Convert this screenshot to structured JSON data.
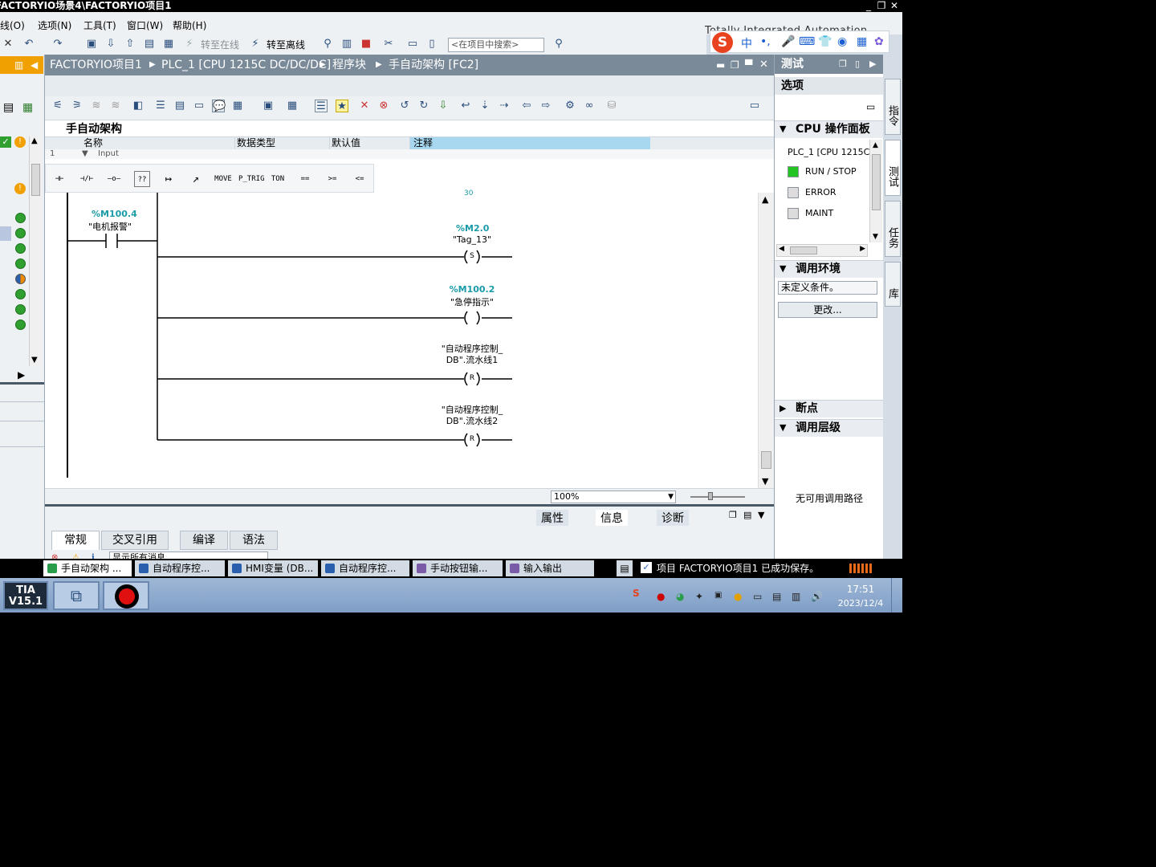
{
  "window": {
    "title": "FACTORYIO场景4\\FACTORYIO项目1",
    "min": "_",
    "restore": "❐",
    "close": "✕"
  },
  "menu": {
    "items": [
      "线(O)",
      "选项(N)",
      "工具(T)",
      "窗口(W)",
      "帮助(H)"
    ],
    "brand": "Totally Integrated Automation"
  },
  "toolbar": {
    "go_online": "转至在线",
    "go_offline": "转至离线",
    "search_placeholder": "<在项目中搜索>"
  },
  "ime": {
    "logo": "S",
    "lang": "中",
    "punct": "•,"
  },
  "editor": {
    "breadcrumb": [
      "FACTORYIO项目1",
      "PLC_1 [CPU 1215C DC/DC/DC]",
      "程序块",
      "手自动架构 [FC2]"
    ],
    "block_title": "手自动架构",
    "interface_columns": [
      "名称",
      "数据类型",
      "默认值",
      "注释"
    ],
    "interface_row": {
      "num": "1",
      "name": "Input"
    },
    "favorites": [
      "⊣⊢",
      "⊣/⊢",
      "–o–",
      "??",
      "↦",
      "↗",
      "MOVE",
      "P_TRIG",
      "TON",
      "==",
      ">=",
      "<="
    ],
    "zoom": "100%"
  },
  "ladder": {
    "contact": {
      "address": "%M100.4",
      "name": "\"电机报警\""
    },
    "coils": [
      {
        "address": "%M2.0",
        "name": "\"Tag_13\"",
        "type": "S"
      },
      {
        "address": "%M100.2",
        "name": "\"急停指示\"",
        "type": ""
      },
      {
        "address": "",
        "name": "\"自动程序控制_\nDB\".流水线1",
        "type": "R"
      },
      {
        "address": "",
        "name": "\"自动程序控制_\nDB\".流水线2",
        "type": "R"
      }
    ],
    "top_clip": "30"
  },
  "inspector": {
    "tabs": [
      "属性",
      "信息",
      "诊断"
    ],
    "subtabs": [
      "常规",
      "交叉引用",
      "编译",
      "语法"
    ],
    "filter_text": "显示所有消息"
  },
  "testpanel": {
    "title": "测试",
    "options": "选项",
    "cpu_panel": "CPU 操作面板",
    "plc_name": "PLC_1 [CPU 1215C",
    "leds": [
      {
        "label": "RUN / STOP",
        "color": "#22c522"
      },
      {
        "label": "ERROR",
        "color": "#dcdcdc"
      },
      {
        "label": "MAINT",
        "color": "#dcdcdc"
      }
    ],
    "call_env": "调用环境",
    "undefined_condition": "未定义条件。",
    "change_button": "更改...",
    "breakpoints": "断点",
    "call_hierarchy": "调用层级",
    "no_call_path": "无可用调用路径"
  },
  "vertical_tabs": [
    "指令",
    "测试",
    "任务",
    "库"
  ],
  "portal_tabs": [
    {
      "label": "手自动架构 ...",
      "active": true
    },
    {
      "label": "自动程序控...",
      "active": false
    },
    {
      "label": "HMI变量 (DB...",
      "active": false
    },
    {
      "label": "自动程序控...",
      "active": false
    },
    {
      "label": "手动按钮输...",
      "active": false
    },
    {
      "label": "输入输出",
      "active": false
    }
  ],
  "status_message": "项目 FACTORYIO项目1 已成功保存。",
  "taskbar": {
    "tia_label": "TIA\nV15.1",
    "time": "17:51",
    "date": "2023/12/4"
  },
  "colors": {
    "accent": "#f0a000",
    "address": "#1a9ba8",
    "title_bar": "#7a8a99"
  }
}
